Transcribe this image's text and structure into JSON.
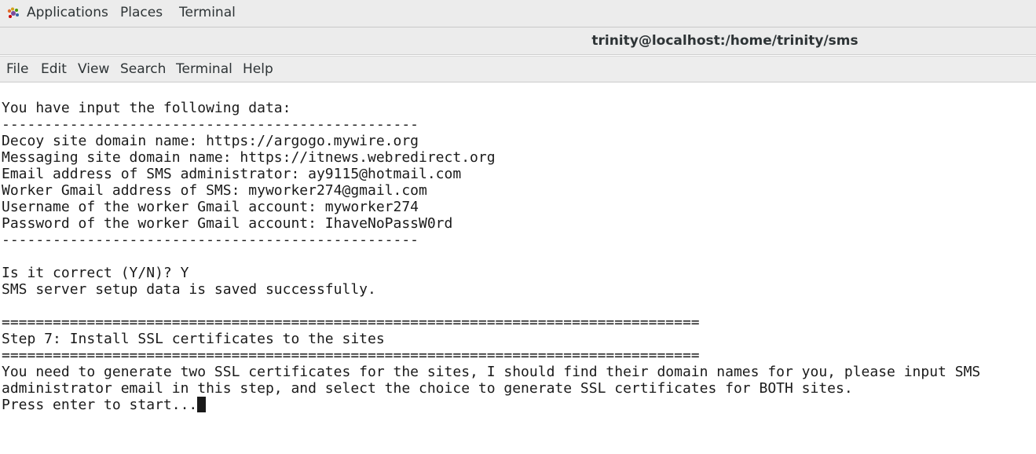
{
  "topbar": {
    "applications": "Applications",
    "places": "Places",
    "terminal": "Terminal"
  },
  "window": {
    "title": "trinity@localhost:/home/trinity/sms"
  },
  "menu": {
    "file": "File",
    "edit": "Edit",
    "view": "View",
    "search": "Search",
    "terminal": "Terminal",
    "help": "Help"
  },
  "terminal": {
    "lines": [
      "You have input the following data:",
      "-------------------------------------------------",
      "Decoy site domain name: https://argogo.mywire.org",
      "Messaging site domain name: https://itnews.webredirect.org",
      "Email address of SMS administrator: ay9115@hotmail.com",
      "Worker Gmail address of SMS: myworker274@gmail.com",
      "Username of the worker Gmail account: myworker274",
      "Password of the worker Gmail account: IhaveNoPassW0rd",
      "-------------------------------------------------",
      "",
      "Is it correct (Y/N)? Y",
      "SMS server setup data is saved successfully.",
      "",
      "==================================================================================",
      "Step 7: Install SSL certificates to the sites",
      "==================================================================================",
      "You need to generate two SSL certificates for the sites, I should find their domain names for you, please input SMS",
      "administrator email in this step, and select the choice to generate SSL certificates for BOTH sites.",
      "Press enter to start..."
    ]
  }
}
